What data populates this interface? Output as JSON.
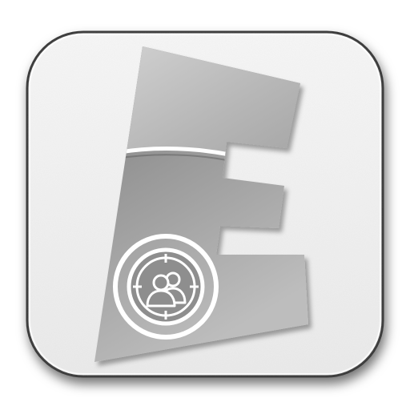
{
  "icon": {
    "logo_letter": "E",
    "center_symbol": "users-target-icon",
    "colors": {
      "tile": "#f2f2f2",
      "tile_border": "#3a3a3a",
      "letter_light": "#c9c9c9",
      "letter_dark": "#7d7d7d",
      "emblem_ring": "#ffffff",
      "emblem_fill": "#8e8e8e"
    }
  }
}
